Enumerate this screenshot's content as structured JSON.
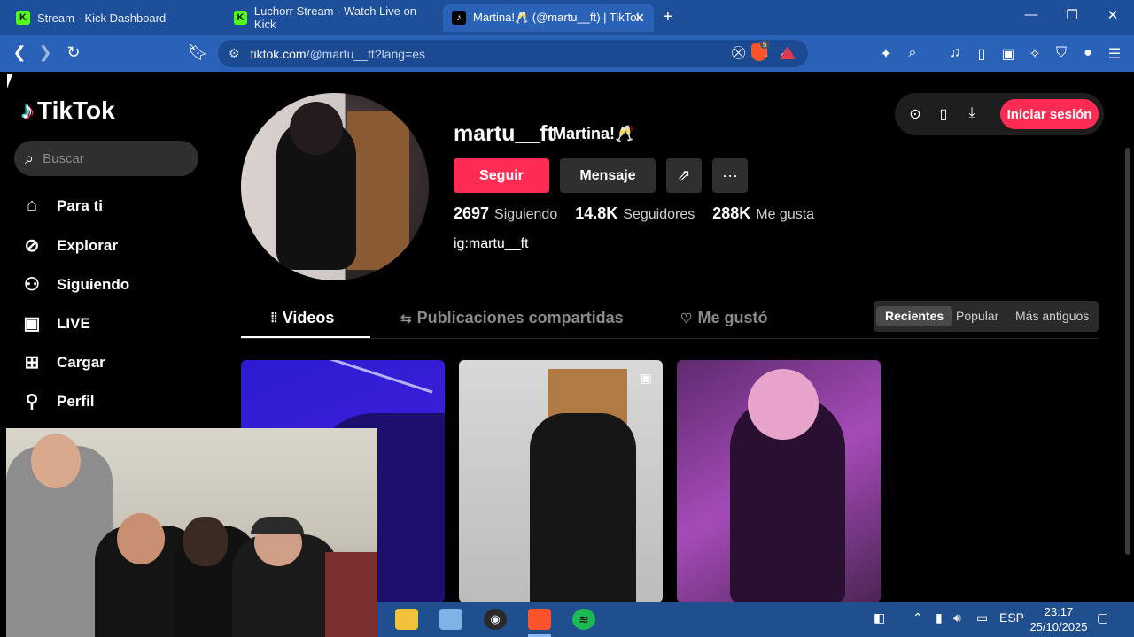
{
  "browser": {
    "tabs": [
      {
        "favicon": "K",
        "title": "Stream - Kick Dashboard"
      },
      {
        "favicon": "K",
        "title": "Luchorr Stream - Watch Live on Kick"
      },
      {
        "favicon": "♪",
        "title": "Martina!🥂 (@martu__ft) | TikTok"
      }
    ],
    "new_tab": "+",
    "url_host": "tiktok.com",
    "url_path": "/@martu__ft?lang=es",
    "brave_badge": "5"
  },
  "tiktok": {
    "logo": "TikTok",
    "search_placeholder": "Buscar",
    "nav": [
      {
        "label": "Para ti",
        "icon": "home-icon"
      },
      {
        "label": "Explorar",
        "icon": "compass-icon"
      },
      {
        "label": "Siguiendo",
        "icon": "following-icon"
      },
      {
        "label": "LIVE",
        "icon": "live-icon"
      },
      {
        "label": "Cargar",
        "icon": "upload-icon"
      },
      {
        "label": "Perfil",
        "icon": "profile-icon"
      }
    ],
    "login_label": "Iniciar sesión"
  },
  "profile": {
    "username": "martu__ft",
    "display_name": "Martina!🥂",
    "follow_label": "Seguir",
    "message_label": "Mensaje",
    "stats": [
      {
        "value": "2697",
        "label": "Siguiendo"
      },
      {
        "value": "14.8K",
        "label": "Seguidores"
      },
      {
        "value": "288K",
        "label": "Me gusta"
      }
    ],
    "bio": "ig:martu__ft",
    "tabs": [
      "Videos",
      "Publicaciones compartidas",
      "Me gustó"
    ],
    "sort": [
      "Recientes",
      "Popular",
      "Más antiguos"
    ]
  },
  "taskbar": {
    "lang": "ESP",
    "time": "23:17",
    "date": "25/10/2025"
  }
}
